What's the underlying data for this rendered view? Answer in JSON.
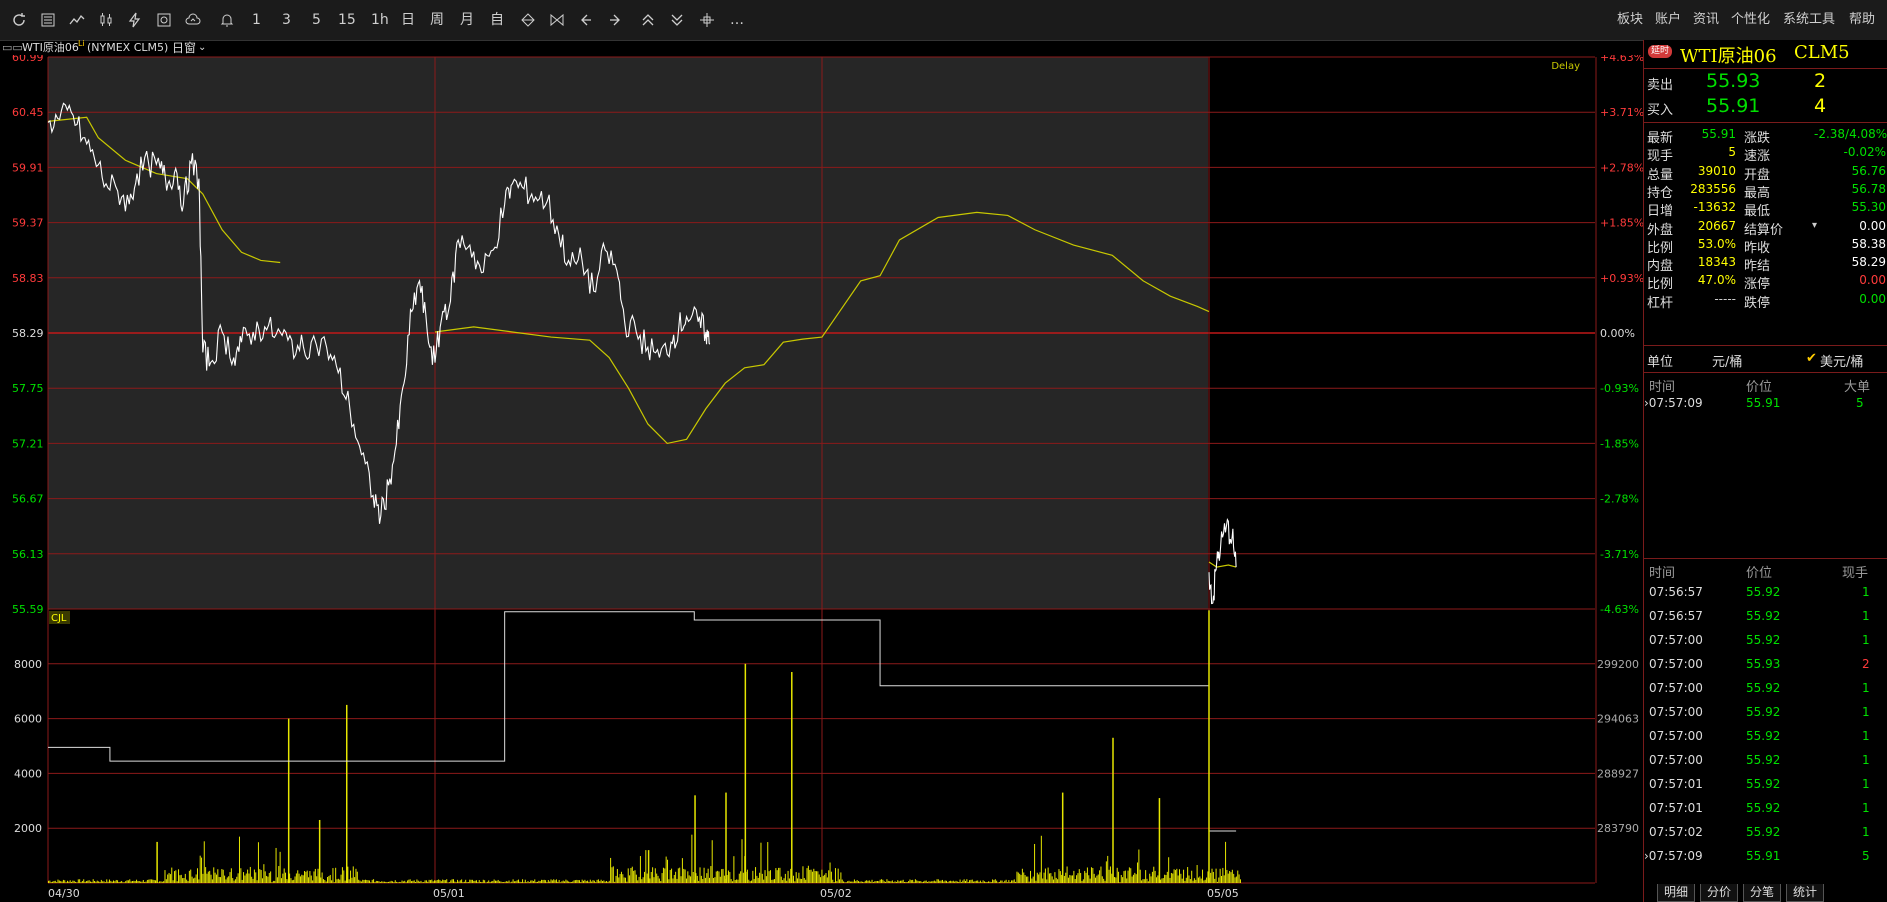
{
  "toolbar": {
    "left_text_buttons": [
      "1",
      "3",
      "5",
      "15",
      "1h",
      "日",
      "周",
      "月",
      "自"
    ],
    "menu": [
      "板块",
      "账户",
      "资讯",
      "个性化",
      "系统工具",
      "帮助"
    ],
    "more": "…"
  },
  "chart_header": {
    "symbol": "WTI原油06",
    "superscript": "Li",
    "code": "(NYMEX CLM5)",
    "window_label": "日窗",
    "delay": "Delay"
  },
  "colors": {
    "price_line": "#ffffff",
    "avg_line": "#c8c800",
    "volume_bar": "#e6e600",
    "grid": "#8b1a1a",
    "up": "#ff3b3b",
    "down": "#00e000",
    "yellow": "#ffff00",
    "plot_bg": "#262626"
  },
  "chart_data": {
    "type": "line",
    "title": "WTI原油06 (NYMEX CLM5)",
    "x_tick_labels": [
      "04/30",
      "05/01",
      "05/02",
      "05/05"
    ],
    "price_axis": {
      "ylim": [
        55.59,
        60.99
      ],
      "left_ticks": [
        "60.99",
        "60.45",
        "59.91",
        "59.37",
        "58.83",
        "58.29",
        "57.75",
        "57.21",
        "56.67",
        "56.13",
        "55.59"
      ],
      "right_ticks": [
        "+4.63%",
        "+3.71%",
        "+2.78%",
        "+1.85%",
        "+0.93%",
        "0.00%",
        "-0.93%",
        "-1.85%",
        "-2.78%",
        "-3.71%",
        "-4.63%"
      ],
      "prev_settlement": 58.29
    },
    "price_series": [
      {
        "x": 0,
        "y": 60.35
      },
      {
        "x": 0.03,
        "y": 60.38
      },
      {
        "x": 0.06,
        "y": 60.45
      },
      {
        "x": 0.09,
        "y": 60.2
      },
      {
        "x": 0.12,
        "y": 60.0
      },
      {
        "x": 0.15,
        "y": 59.75
      },
      {
        "x": 0.18,
        "y": 59.68
      },
      {
        "x": 0.21,
        "y": 59.55
      },
      {
        "x": 0.23,
        "y": 59.85
      },
      {
        "x": 0.26,
        "y": 59.95
      },
      {
        "x": 0.29,
        "y": 59.9
      },
      {
        "x": 0.31,
        "y": 59.75
      },
      {
        "x": 0.33,
        "y": 59.9
      },
      {
        "x": 0.35,
        "y": 59.55
      },
      {
        "x": 0.37,
        "y": 59.95
      },
      {
        "x": 0.39,
        "y": 59.8
      },
      {
        "x": 0.4,
        "y": 58.1
      },
      {
        "x": 0.42,
        "y": 58.0
      },
      {
        "x": 0.45,
        "y": 58.3
      },
      {
        "x": 0.48,
        "y": 58.05
      },
      {
        "x": 0.5,
        "y": 58.2
      },
      {
        "x": 0.53,
        "y": 58.3
      },
      {
        "x": 0.56,
        "y": 58.35
      },
      {
        "x": 0.59,
        "y": 58.28
      },
      {
        "x": 0.62,
        "y": 58.22
      },
      {
        "x": 0.65,
        "y": 58.12
      },
      {
        "x": 0.68,
        "y": 58.2
      },
      {
        "x": 0.72,
        "y": 58.15
      },
      {
        "x": 0.75,
        "y": 57.9
      },
      {
        "x": 0.78,
        "y": 57.55
      },
      {
        "x": 0.81,
        "y": 57.1
      },
      {
        "x": 0.84,
        "y": 56.7
      },
      {
        "x": 0.86,
        "y": 56.5
      },
      {
        "x": 0.88,
        "y": 56.8
      },
      {
        "x": 0.9,
        "y": 57.2
      },
      {
        "x": 0.92,
        "y": 57.8
      },
      {
        "x": 0.94,
        "y": 58.5
      },
      {
        "x": 0.96,
        "y": 58.8
      },
      {
        "x": 0.98,
        "y": 58.3
      },
      {
        "x": 1.0,
        "y": 58.0
      },
      {
        "x": 1.02,
        "y": 58.5
      },
      {
        "x": 1.04,
        "y": 58.6
      },
      {
        "x": 1.06,
        "y": 59.2
      },
      {
        "x": 1.09,
        "y": 59.15
      },
      {
        "x": 1.12,
        "y": 58.88
      },
      {
        "x": 1.15,
        "y": 59.1
      },
      {
        "x": 1.18,
        "y": 59.55
      },
      {
        "x": 1.2,
        "y": 59.75
      },
      {
        "x": 1.23,
        "y": 59.7
      },
      {
        "x": 1.26,
        "y": 59.62
      },
      {
        "x": 1.29,
        "y": 59.58
      },
      {
        "x": 1.32,
        "y": 59.25
      },
      {
        "x": 1.35,
        "y": 58.95
      },
      {
        "x": 1.38,
        "y": 59.0
      },
      {
        "x": 1.41,
        "y": 58.7
      },
      {
        "x": 1.44,
        "y": 59.1
      },
      {
        "x": 1.47,
        "y": 58.9
      },
      {
        "x": 1.49,
        "y": 58.4
      },
      {
        "x": 1.52,
        "y": 58.3
      },
      {
        "x": 1.55,
        "y": 58.15
      },
      {
        "x": 1.58,
        "y": 58.05
      },
      {
        "x": 1.61,
        "y": 58.2
      },
      {
        "x": 1.63,
        "y": 58.35
      },
      {
        "x": 1.65,
        "y": 58.45
      },
      {
        "x": 1.68,
        "y": 58.4
      },
      {
        "x": 1.7,
        "y": 58.3
      },
      {
        "x": 1.71,
        "y": 58.18
      },
      {
        "x": 3.0,
        "y": 55.95
      },
      {
        "x": 3.01,
        "y": 55.65
      },
      {
        "x": 3.02,
        "y": 56.05
      },
      {
        "x": 3.03,
        "y": 56.2
      },
      {
        "x": 3.045,
        "y": 56.4
      },
      {
        "x": 3.06,
        "y": 56.3
      },
      {
        "x": 3.07,
        "y": 56.0
      }
    ],
    "avg_series": [
      {
        "x": 0,
        "y": 60.36
      },
      {
        "x": 0.1,
        "y": 60.4
      },
      {
        "x": 0.13,
        "y": 60.2
      },
      {
        "x": 0.2,
        "y": 59.98
      },
      {
        "x": 0.28,
        "y": 59.85
      },
      {
        "x": 0.36,
        "y": 59.8
      },
      {
        "x": 0.4,
        "y": 59.65
      },
      {
        "x": 0.45,
        "y": 59.3
      },
      {
        "x": 0.5,
        "y": 59.08
      },
      {
        "x": 0.55,
        "y": 59.0
      },
      {
        "x": 0.6,
        "y": 58.98
      },
      {
        "x": 1.0,
        "y": 58.3
      },
      {
        "x": 1.1,
        "y": 58.35
      },
      {
        "x": 1.2,
        "y": 58.3
      },
      {
        "x": 1.3,
        "y": 58.25
      },
      {
        "x": 1.4,
        "y": 58.22
      },
      {
        "x": 1.45,
        "y": 58.05
      },
      {
        "x": 1.5,
        "y": 57.75
      },
      {
        "x": 1.55,
        "y": 57.4
      },
      {
        "x": 1.6,
        "y": 57.21
      },
      {
        "x": 1.65,
        "y": 57.25
      },
      {
        "x": 1.7,
        "y": 57.55
      },
      {
        "x": 1.75,
        "y": 57.8
      },
      {
        "x": 1.8,
        "y": 57.95
      },
      {
        "x": 1.85,
        "y": 57.98
      },
      {
        "x": 1.9,
        "y": 58.2
      },
      {
        "x": 1.95,
        "y": 58.23
      },
      {
        "x": 2.0,
        "y": 58.25
      },
      {
        "x": 2.1,
        "y": 58.8
      },
      {
        "x": 2.15,
        "y": 58.85
      },
      {
        "x": 2.2,
        "y": 59.2
      },
      {
        "x": 2.3,
        "y": 59.42
      },
      {
        "x": 2.4,
        "y": 59.47
      },
      {
        "x": 2.48,
        "y": 59.44
      },
      {
        "x": 2.55,
        "y": 59.3
      },
      {
        "x": 2.65,
        "y": 59.15
      },
      {
        "x": 2.75,
        "y": 59.05
      },
      {
        "x": 2.83,
        "y": 58.8
      },
      {
        "x": 2.9,
        "y": 58.65
      },
      {
        "x": 2.97,
        "y": 58.55
      },
      {
        "x": 3.0,
        "y": 58.5
      },
      {
        "x": 3.0,
        "y": 56.05
      },
      {
        "x": 3.02,
        "y": 56.0
      },
      {
        "x": 3.05,
        "y": 56.02
      },
      {
        "x": 3.07,
        "y": 56.0
      }
    ],
    "volume_axis": {
      "label": "CJL",
      "ylim": [
        0,
        10000
      ],
      "left_ticks": [
        "8000",
        "6000",
        "4000",
        "2000"
      ],
      "right_ticks": [
        "299200",
        "294063",
        "288927",
        "283790"
      ]
    },
    "volume_spikes": [
      {
        "x": 0.28,
        "y": 1500
      },
      {
        "x": 0.62,
        "y": 6000
      },
      {
        "x": 0.7,
        "y": 2300
      },
      {
        "x": 0.77,
        "y": 6500
      },
      {
        "x": 1.55,
        "y": 1200
      },
      {
        "x": 1.67,
        "y": 3200
      },
      {
        "x": 1.75,
        "y": 3300
      },
      {
        "x": 1.8,
        "y": 8000
      },
      {
        "x": 1.92,
        "y": 7700
      },
      {
        "x": 2.62,
        "y": 3300
      },
      {
        "x": 2.75,
        "y": 5300
      },
      {
        "x": 2.87,
        "y": 3100
      }
    ],
    "open_interest_series": [
      {
        "x": 0,
        "y": 4950
      },
      {
        "x": 0.16,
        "y": 4950
      },
      {
        "x": 0.16,
        "y": 4450
      },
      {
        "x": 0.7,
        "y": 4450
      },
      {
        "x": 0.7,
        "y": 4450
      },
      {
        "x": 1.18,
        "y": 4450
      },
      {
        "x": 1.18,
        "y": 9900
      },
      {
        "x": 1.67,
        "y": 9900
      },
      {
        "x": 1.67,
        "y": 9600
      },
      {
        "x": 2.15,
        "y": 9600
      },
      {
        "x": 2.15,
        "y": 7200
      },
      {
        "x": 3.0,
        "y": 7200
      },
      {
        "x": 3.0,
        "y": 9950
      }
    ]
  },
  "quote_panel": {
    "badge": "延时",
    "name": "WTI原油06",
    "code": "CLM5",
    "ask_label": "卖出",
    "ask_price": "55.93",
    "ask_vol": "2",
    "bid_label": "买入",
    "bid_price": "55.91",
    "bid_vol": "4",
    "rows": [
      {
        "l1": "最新",
        "v1": "55.91",
        "c1": "#00e000",
        "l2": "涨跌",
        "v2": "-2.38/4.08%",
        "c2": "#00e000"
      },
      {
        "l1": "现手",
        "v1": "5",
        "c1": "#ffff00",
        "l2": "速涨",
        "v2": "-0.02%",
        "c2": "#00e000"
      },
      {
        "l1": "总量",
        "v1": "39010",
        "c1": "#ffff00",
        "l2": "开盘",
        "v2": "56.76",
        "c2": "#00e000"
      },
      {
        "l1": "持仓",
        "v1": "283556",
        "c1": "#ffff00",
        "l2": "最高",
        "v2": "56.78",
        "c2": "#00e000"
      },
      {
        "l1": "日增",
        "v1": "-13632",
        "c1": "#ffff00",
        "l2": "最低",
        "v2": "55.30",
        "c2": "#00e000"
      },
      {
        "l1": "外盘",
        "v1": "20667",
        "c1": "#ffff00",
        "l2": "结算价",
        "v2": "0.00",
        "c2": "#ffffff"
      },
      {
        "l1": "比例",
        "v1": "53.0%",
        "c1": "#ffff00",
        "l2": "昨收",
        "v2": "58.38",
        "c2": "#ffffff"
      },
      {
        "l1": "内盘",
        "v1": "18343",
        "c1": "#ffff00",
        "l2": "昨结",
        "v2": "58.29",
        "c2": "#ffffff"
      },
      {
        "l1": "比例",
        "v1": "47.0%",
        "c1": "#ffff00",
        "l2": "涨停",
        "v2": "0.00",
        "c2": "#ff3b3b"
      },
      {
        "l1": "杠杆",
        "v1": "-----",
        "c1": "#cccccc",
        "l2": "跌停",
        "v2": "0.00",
        "c2": "#00e000"
      }
    ],
    "unit_label": "单位",
    "unit_cny": "元/桶",
    "unit_usd": "美元/桶",
    "block_trades": {
      "headers": [
        "时间",
        "价位",
        "大单"
      ],
      "rows": [
        {
          "time": "07:57:09",
          "price": "55.91",
          "vol": "5"
        }
      ]
    },
    "ticks": {
      "headers": [
        "时间",
        "价位",
        "现手"
      ],
      "rows": [
        {
          "time": "07:56:57",
          "price": "55.92",
          "vol": "1",
          "vc": "#00e000"
        },
        {
          "time": "07:56:57",
          "price": "55.92",
          "vol": "1",
          "vc": "#00e000"
        },
        {
          "time": "07:57:00",
          "price": "55.92",
          "vol": "1",
          "vc": "#00e000"
        },
        {
          "time": "07:57:00",
          "price": "55.93",
          "vol": "2",
          "vc": "#ff3b3b"
        },
        {
          "time": "07:57:00",
          "price": "55.92",
          "vol": "1",
          "vc": "#00e000"
        },
        {
          "time": "07:57:00",
          "price": "55.92",
          "vol": "1",
          "vc": "#00e000"
        },
        {
          "time": "07:57:00",
          "price": "55.92",
          "vol": "1",
          "vc": "#00e000"
        },
        {
          "time": "07:57:00",
          "price": "55.92",
          "vol": "1",
          "vc": "#00e000"
        },
        {
          "time": "07:57:01",
          "price": "55.92",
          "vol": "1",
          "vc": "#00e000"
        },
        {
          "time": "07:57:01",
          "price": "55.92",
          "vol": "1",
          "vc": "#00e000"
        },
        {
          "time": "07:57:02",
          "price": "55.92",
          "vol": "1",
          "vc": "#00e000"
        },
        {
          "time": "07:57:09",
          "price": "55.91",
          "vol": "5",
          "vc": "#00e000"
        }
      ]
    },
    "tabs": [
      "明细",
      "分价",
      "分笔",
      "统计"
    ]
  }
}
